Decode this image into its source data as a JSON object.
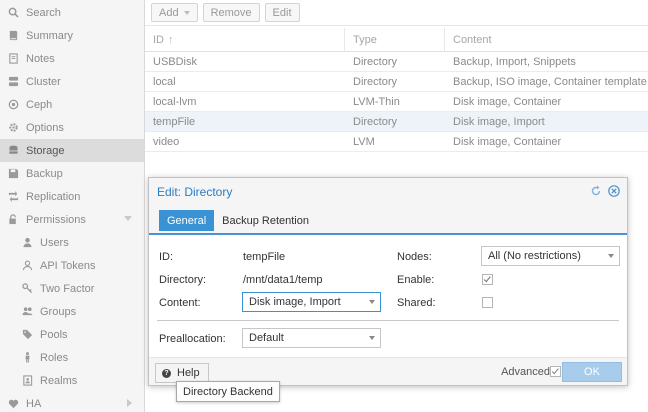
{
  "sidebar": {
    "items": [
      {
        "label": "Search",
        "icon": "search-icon"
      },
      {
        "label": "Summary",
        "icon": "book-icon"
      },
      {
        "label": "Notes",
        "icon": "notes-icon"
      },
      {
        "label": "Cluster",
        "icon": "server-icon"
      },
      {
        "label": "Ceph",
        "icon": "ceph-icon"
      },
      {
        "label": "Options",
        "icon": "gear-icon"
      },
      {
        "label": "Storage",
        "icon": "database-icon"
      },
      {
        "label": "Backup",
        "icon": "floppy-icon"
      },
      {
        "label": "Replication",
        "icon": "retweet-icon"
      },
      {
        "label": "Permissions",
        "icon": "unlock-icon"
      },
      {
        "label": "Users",
        "icon": "user-icon"
      },
      {
        "label": "API Tokens",
        "icon": "user-outline-icon"
      },
      {
        "label": "Two Factor",
        "icon": "key-icon"
      },
      {
        "label": "Groups",
        "icon": "users-icon"
      },
      {
        "label": "Pools",
        "icon": "tags-icon"
      },
      {
        "label": "Roles",
        "icon": "male-icon"
      },
      {
        "label": "Realms",
        "icon": "address-book-icon"
      },
      {
        "label": "HA",
        "icon": "heartbeat-icon"
      }
    ]
  },
  "toolbar": {
    "add_label": "Add",
    "remove_label": "Remove",
    "edit_label": "Edit"
  },
  "grid": {
    "columns": {
      "id": "ID",
      "type": "Type",
      "content": "Content"
    },
    "rows": [
      {
        "id": "USBDisk",
        "type": "Directory",
        "content": "Backup, Import, Snippets"
      },
      {
        "id": "local",
        "type": "Directory",
        "content": "Backup, ISO image, Container template"
      },
      {
        "id": "local-lvm",
        "type": "LVM-Thin",
        "content": "Disk image, Container"
      },
      {
        "id": "tempFile",
        "type": "Directory",
        "content": "Disk image, Import"
      },
      {
        "id": "video",
        "type": "LVM",
        "content": "Disk image, Container"
      }
    ]
  },
  "dialog": {
    "title": "Edit: Directory",
    "tabs": [
      "General",
      "Backup Retention"
    ],
    "fields": {
      "id_label": "ID:",
      "id_value": "tempFile",
      "directory_label": "Directory:",
      "directory_value": "/mnt/data1/temp",
      "content_label": "Content:",
      "content_value": "Disk image, Import",
      "nodes_label": "Nodes:",
      "nodes_value": "All (No restrictions)",
      "enable_label": "Enable:",
      "enable_checked": true,
      "shared_label": "Shared:",
      "shared_checked": false,
      "prealloc_label": "Preallocation:",
      "prealloc_value": "Default"
    },
    "footer": {
      "help_label": "Help",
      "advanced_label": "Advanced",
      "ok_label": "OK"
    }
  },
  "tooltip": {
    "text": "Directory Backend"
  },
  "colors": {
    "accent": "#3892d3",
    "title": "#2c7cc2",
    "ok_disabled": "#a8cdec",
    "selected_row": "#edf3f9"
  }
}
